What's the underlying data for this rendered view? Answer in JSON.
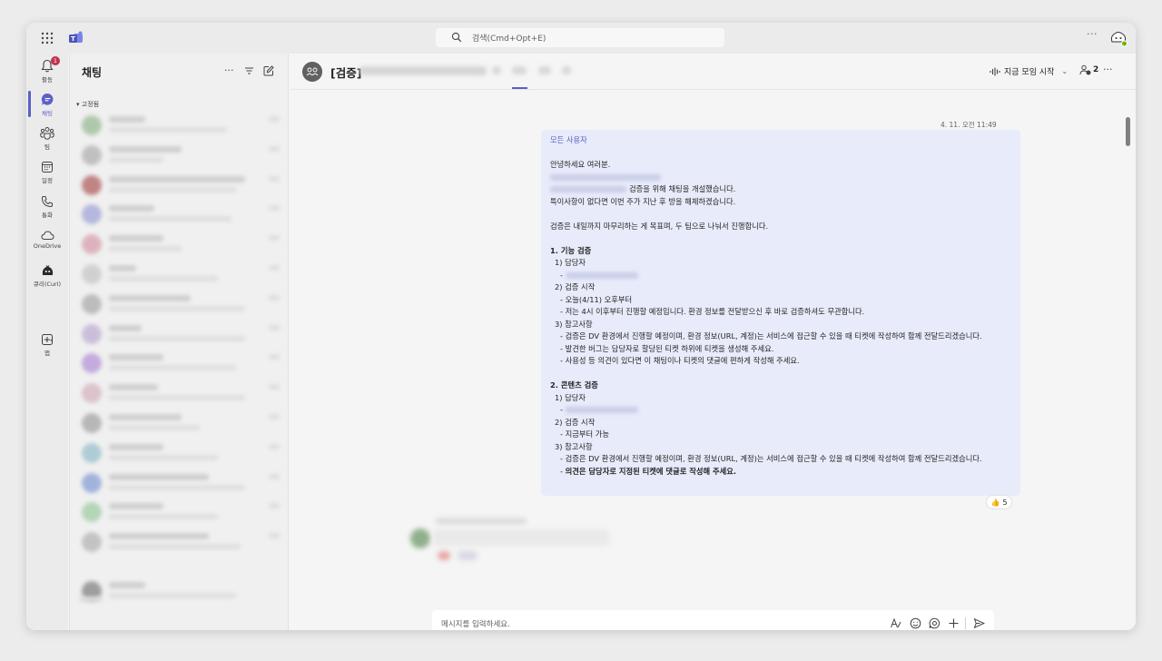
{
  "titlebar": {
    "search_placeholder": "검색(Cmd+Opt+E)",
    "more": "···"
  },
  "rail": {
    "items": [
      {
        "label": "활동",
        "icon": "bell-icon",
        "badge": "1"
      },
      {
        "label": "채팅",
        "icon": "chat-icon",
        "active": true
      },
      {
        "label": "팀",
        "icon": "teams-icon"
      },
      {
        "label": "일정",
        "icon": "calendar-icon"
      },
      {
        "label": "통화",
        "icon": "phone-icon"
      },
      {
        "label": "OneDrive",
        "icon": "cloud-icon"
      },
      {
        "label": "큐리(Curi)",
        "icon": "curi-app-icon"
      }
    ],
    "more": "···",
    "apps_label": "앱"
  },
  "chatlist": {
    "title": "채팅",
    "pinned_section": "고정됨",
    "more": "···"
  },
  "header": {
    "title": "[검증]",
    "meet_label": "지금 모임 시작",
    "participants": "2",
    "more": "···"
  },
  "message": {
    "timestamp": "4. 11. 오전 11:49",
    "mention": "모든 사용자",
    "greeting": "안녕하세요 여러분.",
    "line_open": "검증을 위해 채팅을 개설했습니다.",
    "line_close": "특이사항이 없다면 이번 주가 지난 후 방을 해체하겠습니다.",
    "intro": "검증은 내일까지 마무리하는 게 목표며, 두 팀으로 나눠서 진행합니다.",
    "s1_title": "1. 기능 검증",
    "s1_owner": "1) 담당자",
    "s1_start": "2) 검증 시작",
    "s1_start_a": "- 오늘(4/11) 오후부터",
    "s1_start_b": "- 저는 4시 이후부터 진행할 예정입니다. 환경 정보를 전달받으신 후 바로 검증하셔도 무관합니다.",
    "s1_ref": "3) 참고사항",
    "s1_ref_a": "- 검증은 DV 환경에서 진행할 예정이며, 환경 정보(URL, 계정)는 서비스에 접근할 수 있을 때 티켓에 작성하여 함께 전달드리겠습니다.",
    "s1_ref_b": "- 발견한 버그는 담당자로 할당된 티켓 하위에 티켓을 생성해 주세요.",
    "s1_ref_c": "- 사용성 등 의견이 있다면 이 채팅이나 티켓의 댓글에 편하게 작성해 주세요.",
    "s2_title": "2. 콘텐츠 검증",
    "s2_owner": "1) 담당자",
    "s2_owner_dash": "-",
    "s2_start": "2) 검증 시작",
    "s2_start_a": "- 지금부터 가능",
    "s2_ref": "3) 참고사항",
    "s2_ref_a": "- 검증은 DV 환경에서 진행할 예정이며, 환경 정보(URL, 계정)는 서비스에 접근할 수 있을 때 티켓에 작성하여 함께 전달드리겠습니다.",
    "s2_ref_b_dash": "- ",
    "s2_ref_b": "의견은 담당자로 지정된 티켓에 댓글로 작성해 주세요.",
    "reaction_emoji": "👍",
    "reaction_count": "5"
  },
  "composer": {
    "placeholder": "메시지를 입력하세요."
  },
  "colors": {
    "accent": "#5b5fc7",
    "bubble": "#e8ebfa",
    "badge": "#c4314b"
  }
}
